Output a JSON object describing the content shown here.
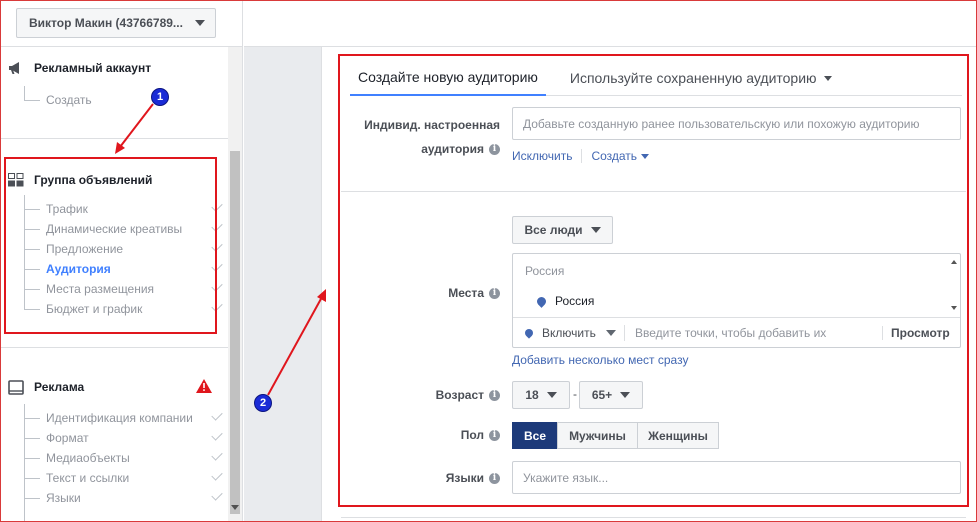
{
  "sidebar": {
    "account_button": "Виктор Макин (43766789...",
    "ad_account": {
      "title": "Рекламный аккаунт",
      "items": [
        {
          "label": "Создать"
        }
      ]
    },
    "ad_set": {
      "title": "Группа объявлений",
      "items": [
        {
          "label": "Трафик"
        },
        {
          "label": "Динамические креативы"
        },
        {
          "label": "Предложение"
        },
        {
          "label": "Аудитория"
        },
        {
          "label": "Места размещения"
        },
        {
          "label": "Бюджет и график"
        }
      ]
    },
    "ad": {
      "title": "Реклама",
      "items": [
        {
          "label": "Идентификация компании"
        },
        {
          "label": "Формат"
        },
        {
          "label": "Медиаобъекты"
        },
        {
          "label": "Текст и ссылки"
        },
        {
          "label": "Языки"
        }
      ]
    }
  },
  "audience": {
    "tabs": {
      "create": "Создайте новую аудиторию",
      "saved": "Используйте сохраненную аудиторию"
    },
    "custom": {
      "label_line1": "Индивид. настроенная",
      "label_line2": "аудитория",
      "placeholder": "Добавьте созданную ранее пользовательскую или похожую аудиторию",
      "exclude": "Исключить",
      "create": "Создать"
    },
    "locations": {
      "label": "Места",
      "who_button": "Все люди",
      "country_header": "Россия",
      "selected": "Россия",
      "include": "Включить",
      "points_placeholder": "Введите точки, чтобы добавить их",
      "preview": "Просмотр",
      "bulk_link": "Добавить несколько мест сразу"
    },
    "age": {
      "label": "Возраст",
      "min": "18",
      "separator": "-",
      "max": "65+"
    },
    "gender": {
      "label": "Пол",
      "options": [
        "Все",
        "Мужчины",
        "Женщины"
      ],
      "selected": "Все"
    },
    "languages": {
      "label": "Языки",
      "placeholder": "Укажите язык..."
    }
  },
  "annotations": {
    "badge1": "1",
    "badge2": "2",
    "arrow_color": "#e0161d",
    "badge_color": "#1a2bd6"
  },
  "icons": {
    "info": "i"
  }
}
